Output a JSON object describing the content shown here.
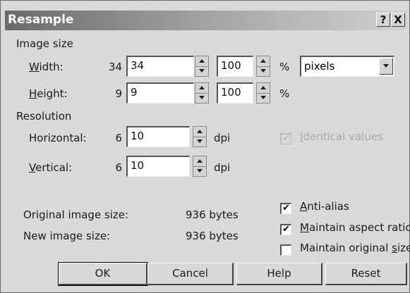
{
  "window": {
    "title": "Resample",
    "help_label": "?",
    "close_label": "X"
  },
  "image_size": {
    "group_label": "Image size",
    "width_label": "Width:",
    "width_original": "34",
    "width_value": "34",
    "width_percent": "100",
    "height_label": "Height:",
    "height_original": "9",
    "height_value": "9",
    "height_percent": "100",
    "percent_symbol": "%",
    "unit_selected": "pixels"
  },
  "resolution": {
    "group_label": "Resolution",
    "horizontal_label": "Horizontal:",
    "horizontal_original": "6",
    "horizontal_value": "10",
    "vertical_label": "Vertical:",
    "vertical_original": "6",
    "vertical_value": "10",
    "unit": "dpi",
    "identical_label": "Identical values",
    "identical_checked": true,
    "identical_enabled": false
  },
  "info": {
    "original_label": "Original image size:",
    "original_value": "936 bytes",
    "new_label": "New image size:",
    "new_value": "936 bytes"
  },
  "options": {
    "anti_alias_label": "Anti-alias",
    "anti_alias_checked": true,
    "aspect_label": "Maintain aspect ratio",
    "aspect_checked": true,
    "original_size_label": "Maintain original size",
    "original_size_checked": false
  },
  "buttons": {
    "ok": "OK",
    "cancel": "Cancel",
    "help": "Help",
    "reset": "Reset"
  },
  "checkmark": "✔"
}
